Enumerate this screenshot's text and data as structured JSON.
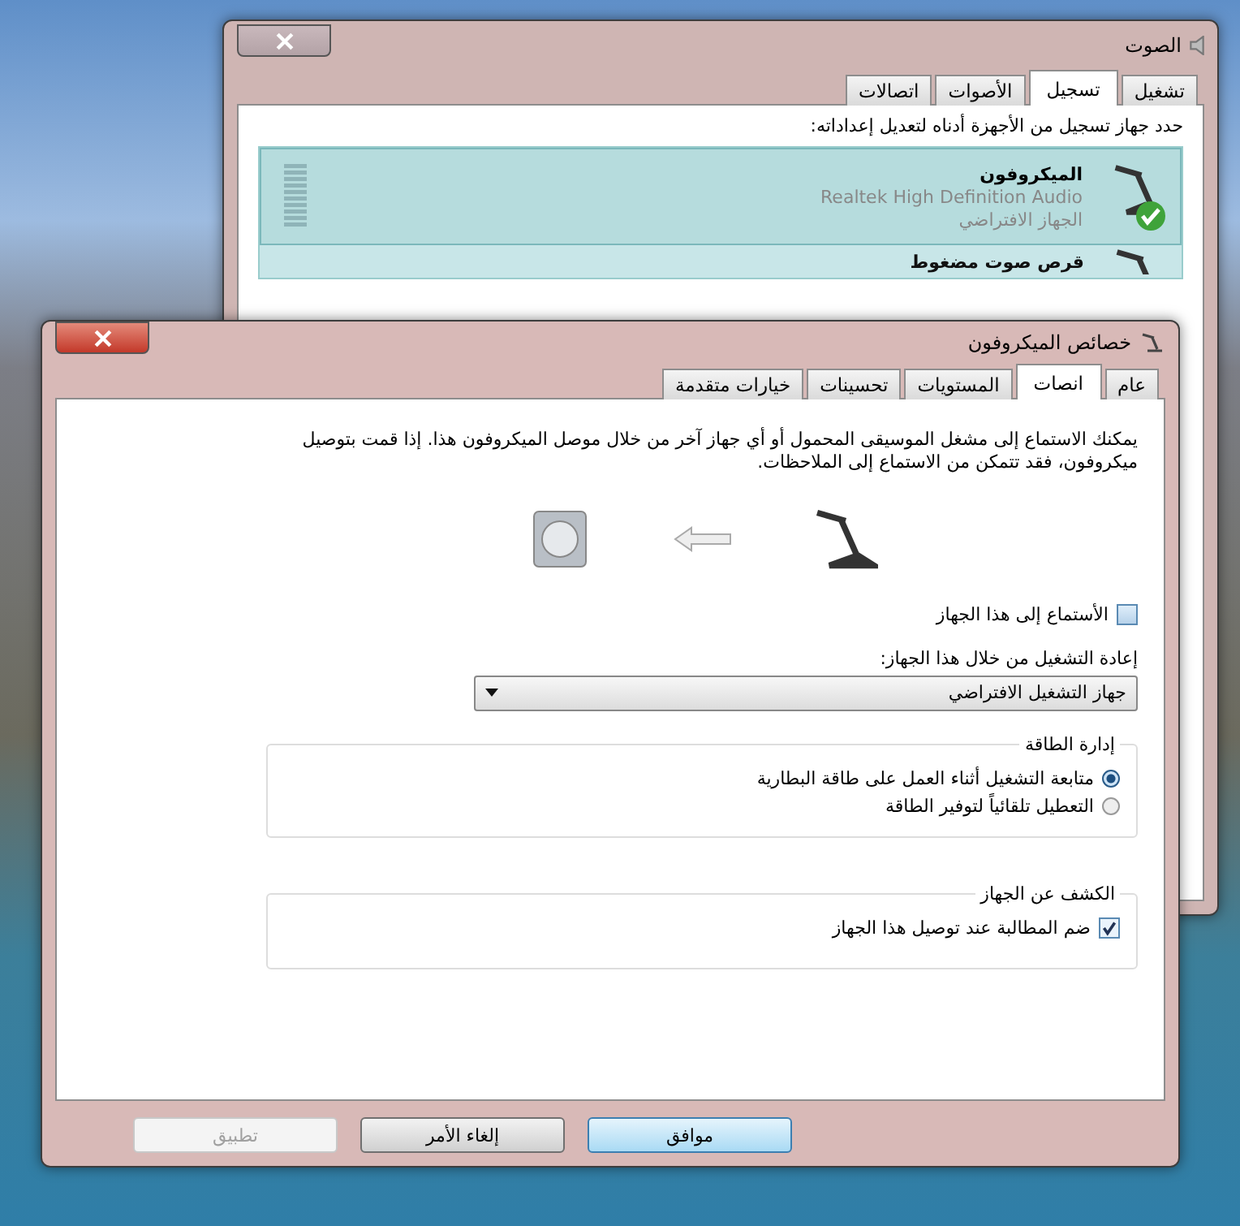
{
  "sound_window": {
    "title": "الصوت",
    "tabs": [
      {
        "label": "تشغيل",
        "selected": false
      },
      {
        "label": "تسجيل",
        "selected": true
      },
      {
        "label": "الأصوات",
        "selected": false
      },
      {
        "label": "اتصالات",
        "selected": false
      }
    ],
    "instruction": "حدد جهاز تسجيل من الأجهزة أدناه لتعديل إعداداته:",
    "devices": [
      {
        "name": "الميكروفون",
        "driver": "Realtek High Definition Audio",
        "status": "الجهاز الافتراضي",
        "selected": true,
        "default": true
      },
      {
        "name": "قرص صوت مضغوط",
        "selected": false,
        "default": false
      }
    ]
  },
  "mic_window": {
    "title": "خصائص الميكروفون",
    "tabs": [
      {
        "label": "عام",
        "selected": false
      },
      {
        "label": "انصات",
        "selected": true
      },
      {
        "label": "المستويات",
        "selected": false
      },
      {
        "label": "تحسينات",
        "selected": false
      },
      {
        "label": "خيارات متقدمة",
        "selected": false
      }
    ],
    "description": "يمكنك الاستماع إلى مشغل الموسيقى المحمول أو أي جهاز آخر من خلال موصل الميكروفون هذا. إذا قمت بتوصيل ميكروفون، فقد تتمكن من الاستماع إلى الملاحظات.",
    "listen": {
      "label": "الأستماع إلى هذا الجهاز",
      "checked": false
    },
    "playback_label": "إعادة التشغيل من خلال هذا الجهاز:",
    "playback_device": "جهاز التشغيل الافتراضي",
    "power": {
      "title": "إدارة الطاقة",
      "options": [
        {
          "label": "متابعة التشغيل أثناء العمل على طاقة البطارية",
          "selected": true
        },
        {
          "label": "التعطيل تلقائياً لتوفير الطاقة",
          "selected": false
        }
      ]
    },
    "detection": {
      "title": "الكشف عن الجهاز",
      "checkbox": {
        "label": "ضم المطالبة عند توصيل هذا الجهاز",
        "checked": true
      }
    },
    "buttons": [
      {
        "label": "موافق",
        "default": true,
        "disabled": false
      },
      {
        "label": "إلغاء الأمر",
        "default": false,
        "disabled": false
      },
      {
        "label": "تطبيق",
        "default": false,
        "disabled": true
      }
    ]
  }
}
